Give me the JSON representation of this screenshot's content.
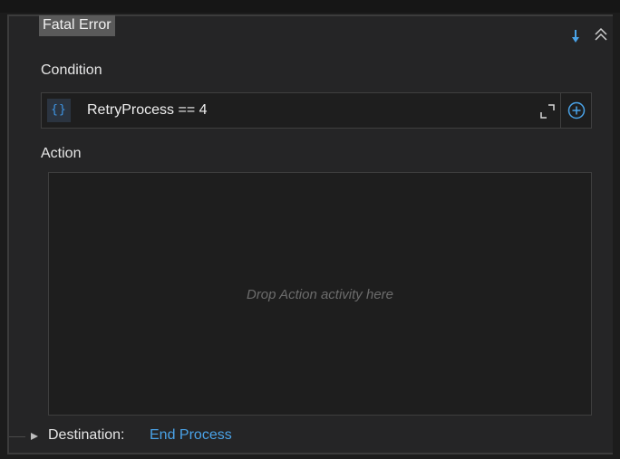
{
  "panel": {
    "title": "Fatal Error",
    "condition": {
      "label": "Condition",
      "brace_icon": "{}",
      "expression": "RetryProcess == 4"
    },
    "action": {
      "label": "Action",
      "drop_hint": "Drop Action activity here"
    },
    "destination": {
      "label": "Destination:",
      "target": "End Process"
    }
  },
  "icons": {
    "move_down": "arrow-down-icon",
    "collapse": "double-chevron-up-icon",
    "expand_editor": "expand-corners-icon",
    "add": "plus-circle-icon",
    "connector": "triangle-right-icon"
  },
  "colors": {
    "background": "#252526",
    "field_background": "#1e1e1e",
    "accent": "#3e96e6",
    "link": "#4aa3e8",
    "title_highlight": "#5a5a5a",
    "hint_text": "#6c6c6c"
  }
}
